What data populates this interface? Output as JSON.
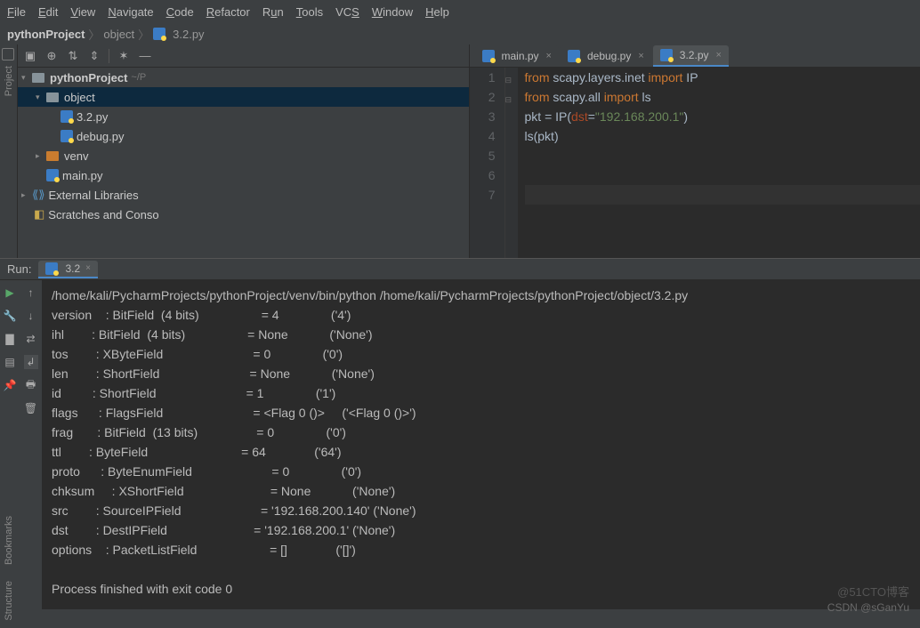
{
  "menu": [
    "File",
    "Edit",
    "View",
    "Navigate",
    "Code",
    "Refactor",
    "Run",
    "Tools",
    "VCS",
    "Window",
    "Help"
  ],
  "breadcrumb": {
    "project": "pythonProject",
    "folder": "object",
    "file": "3.2.py"
  },
  "tree": {
    "root": "pythonProject",
    "root_path": "~/P",
    "object": "object",
    "file1": "3.2.py",
    "file2": "debug.py",
    "venv": "venv",
    "mainpy": "main.py",
    "ext": "External Libraries",
    "scratch": "Scratches and Conso"
  },
  "tabs": [
    {
      "name": "main.py",
      "active": false
    },
    {
      "name": "debug.py",
      "active": false
    },
    {
      "name": "3.2.py",
      "active": true
    }
  ],
  "code_lines": [
    "1",
    "2",
    "3",
    "4",
    "5",
    "6",
    "7"
  ],
  "code": {
    "l1a": "from",
    "l1b": " scapy.layers.inet ",
    "l1c": "import",
    "l1d": " IP",
    "l2a": "from",
    "l2b": " scapy.all ",
    "l2c": "import",
    "l2d": " ls",
    "l3a": "pkt = IP(",
    "l3b": "dst",
    "l3c": "=",
    "l3d": "\"192.168.200.1\"",
    "l3e": ")",
    "l4": "ls(pkt)"
  },
  "run": {
    "label": "Run:",
    "tab": "3.2",
    "cmd": "/home/kali/PycharmProjects/pythonProject/venv/bin/python /home/kali/PycharmProjects/pythonProject/object/3.2.py",
    "rows": [
      "version    : BitField  (4 bits)                  = 4               ('4')",
      "ihl        : BitField  (4 bits)                  = None            ('None')",
      "tos        : XByteField                          = 0               ('0')",
      "len        : ShortField                          = None            ('None')",
      "id         : ShortField                          = 1               ('1')",
      "flags      : FlagsField                          = <Flag 0 ()>     ('<Flag 0 ()>')",
      "frag       : BitField  (13 bits)                 = 0               ('0')",
      "ttl        : ByteField                           = 64              ('64')",
      "proto      : ByteEnumField                       = 0               ('0')",
      "chksum     : XShortField                         = None            ('None')",
      "src        : SourceIPField                       = '192.168.200.140' ('None')",
      "dst        : DestIPField                         = '192.168.200.1' ('None')",
      "options    : PacketListField                     = []              ('[]')"
    ],
    "exit": "Process finished with exit code 0"
  },
  "side_labels": {
    "project": "Project",
    "structure": "Structure",
    "bookmarks": "Bookmarks"
  },
  "watermark": "CSDN @sGanYu",
  "watermark2": "@51CTO博客"
}
